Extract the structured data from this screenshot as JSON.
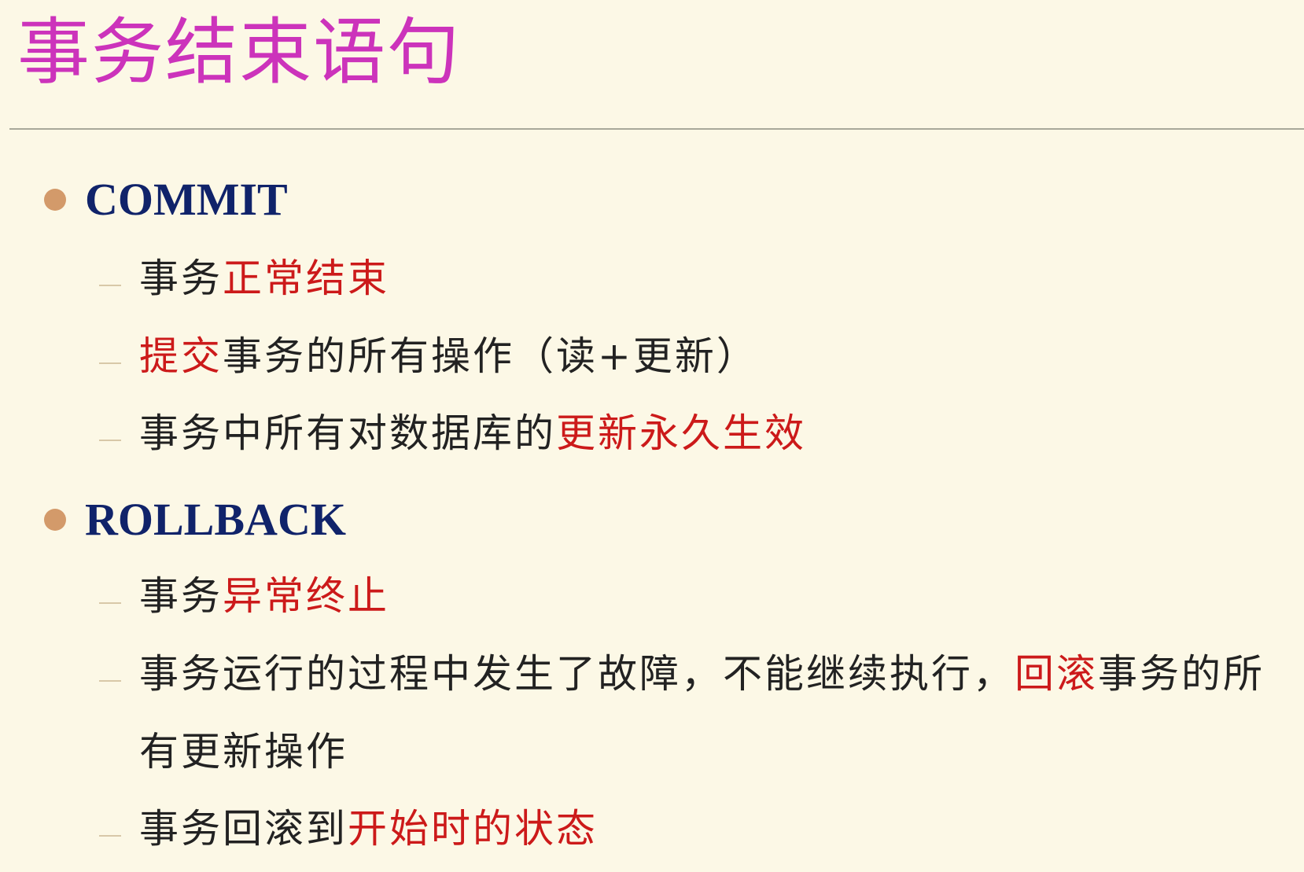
{
  "title": "事务结束语句",
  "sections": [
    {
      "heading": "COMMIT",
      "items": [
        {
          "segments": [
            {
              "text": "事务",
              "red": false
            },
            {
              "text": "正常结束",
              "red": true
            }
          ]
        },
        {
          "segments": [
            {
              "text": "提交",
              "red": true
            },
            {
              "text": "事务的所有操作（读+更新）",
              "red": false
            }
          ]
        },
        {
          "segments": [
            {
              "text": "事务中所有对数据库的",
              "red": false
            },
            {
              "text": "更新永久生效",
              "red": true
            }
          ]
        }
      ]
    },
    {
      "heading": "ROLLBACK",
      "items": [
        {
          "segments": [
            {
              "text": "事务",
              "red": false
            },
            {
              "text": "异常终止",
              "red": true
            }
          ]
        },
        {
          "segments": [
            {
              "text": "事务运行的过程中发生了故障，不能继续执行，",
              "red": false
            },
            {
              "text": "回滚",
              "red": true
            },
            {
              "text": "事务的所",
              "red": false
            }
          ],
          "continuation": "有更新操作"
        },
        {
          "segments": [
            {
              "text": "事务回滚到",
              "red": false
            },
            {
              "text": "开始时的状态",
              "red": true
            }
          ]
        }
      ]
    }
  ],
  "colors": {
    "title": "#cc33bb",
    "heading": "#10236a",
    "highlight": "#cc1a1a",
    "bullet": "#d39a6a",
    "background": "#fcf8e6"
  }
}
